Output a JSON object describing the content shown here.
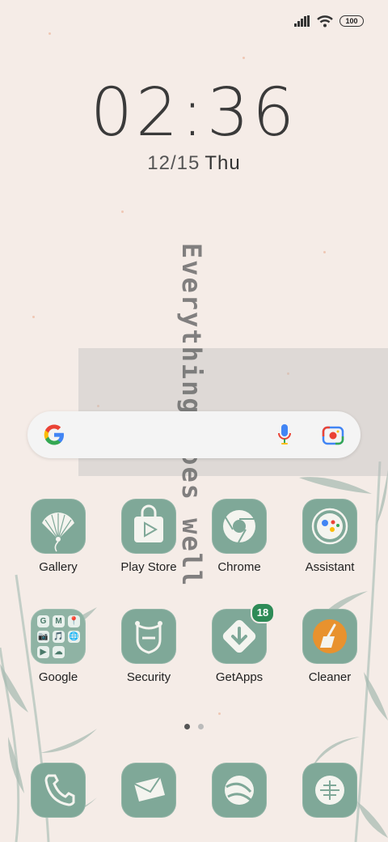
{
  "status_bar": {
    "battery": "100",
    "icons": [
      "signal-icon",
      "wifi-icon",
      "battery-icon"
    ]
  },
  "clock": {
    "time": "02:36",
    "date": "12/15",
    "weekday": "Thu"
  },
  "overlay_text": "Everything goes well",
  "search": {
    "icons": [
      "google-g-icon",
      "mic-icon",
      "lens-camera-icon"
    ]
  },
  "apps_row1": [
    {
      "label": "Gallery",
      "icon": "fan-icon"
    },
    {
      "label": "Play Store",
      "icon": "play-store-bag-icon"
    },
    {
      "label": "Chrome",
      "icon": "chrome-icon"
    },
    {
      "label": "Assistant",
      "icon": "assistant-icon"
    }
  ],
  "apps_row2": [
    {
      "label": "Google",
      "icon": "folder-icon",
      "folder_items": [
        "G",
        "M",
        "📍",
        "📷",
        "🎵",
        "🌐",
        "▶",
        "☁",
        ""
      ]
    },
    {
      "label": "Security",
      "icon": "shield-icon"
    },
    {
      "label": "GetApps",
      "icon": "download-icon",
      "badge": "18"
    },
    {
      "label": "Cleaner",
      "icon": "broom-icon"
    }
  ],
  "dock": [
    {
      "icon": "phone-icon"
    },
    {
      "icon": "messages-icon"
    },
    {
      "icon": "browser-icon"
    },
    {
      "icon": "camera-icon"
    }
  ],
  "page_indicator": {
    "pages": 2,
    "active": 0
  },
  "colors": {
    "tile": "#7fa898",
    "badge": "#2e8b57",
    "background": "#f5ece7"
  }
}
